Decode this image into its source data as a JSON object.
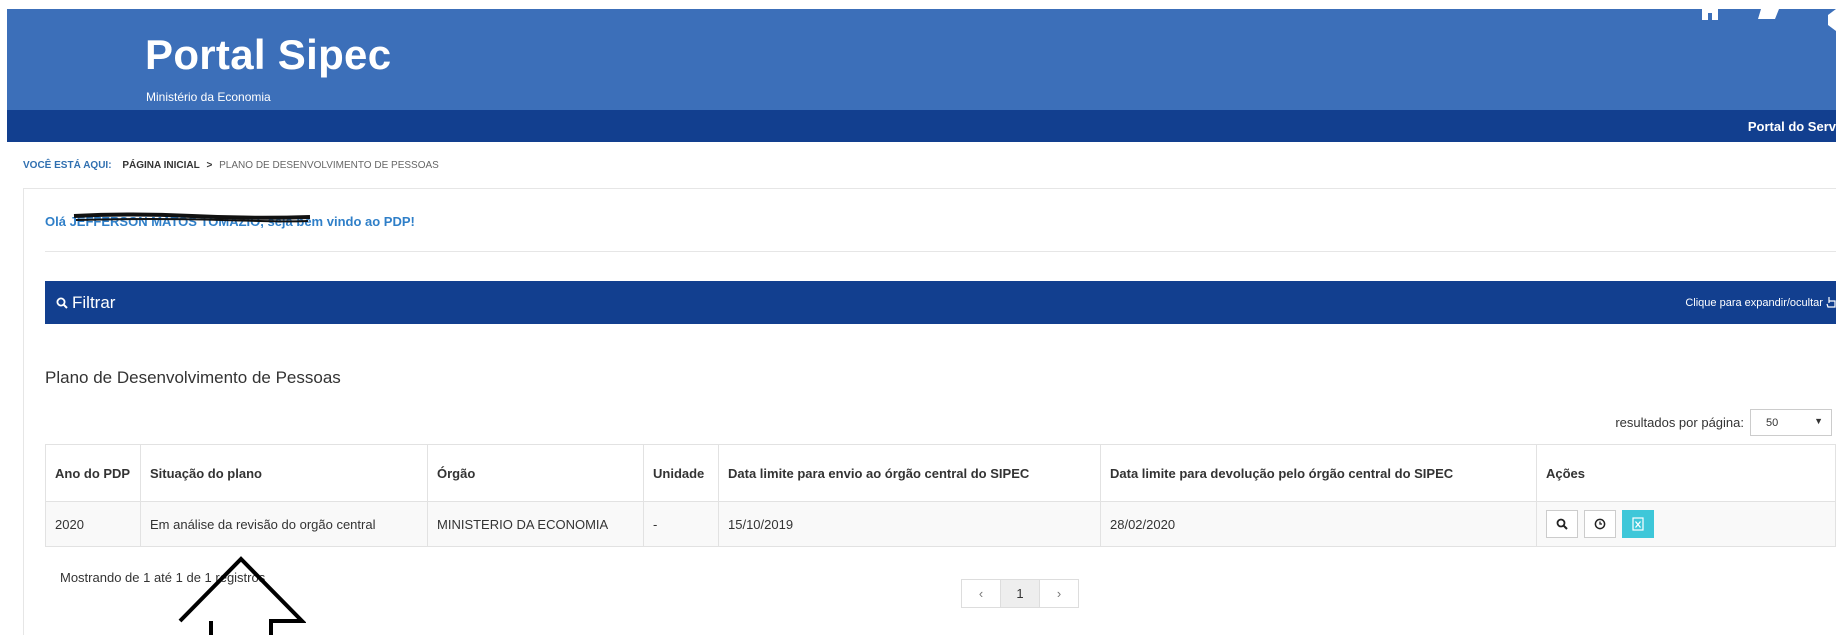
{
  "header": {
    "title": "Portal Sipec",
    "subtitle": "Ministério da Economia",
    "portal_link": "Portal do Serv",
    "brand_color": "#3c6fb9",
    "nav_color": "#123f8f"
  },
  "breadcrumb": {
    "lead": "VOCÊ ESTÁ AQUI:",
    "home": "PÁGINA INICIAL",
    "separator": ">",
    "current": "PLANO DE DESENVOLVIMENTO DE PESSOAS"
  },
  "welcome": {
    "greeting": "Olá JEFFERSON MATOS TOMAZIO, seja bem vindo ao PDP!",
    "color": "#2f7fc8"
  },
  "filter": {
    "label": "Filtrar",
    "toggle_label": "Clique para expandir/ocultar"
  },
  "section": {
    "title": "Plano de Desenvolvimento de Pessoas",
    "per_page_label": "resultados por página:",
    "per_page_value": "50"
  },
  "table": {
    "headers": [
      "Ano do PDP",
      "Situação do plano",
      "Órgão",
      "Unidade",
      "Data limite para envio ao órgão central do SIPEC",
      "Data limite para devolução pelo órgão central do SIPEC",
      "Ações"
    ],
    "rows": [
      {
        "ano": "2020",
        "situacao": "Em análise da revisão do orgão central",
        "orgao": "MINISTERIO DA ECONOMIA",
        "unidade": "-",
        "data_envio": "15/10/2019",
        "data_devolucao": "28/02/2020",
        "actions": [
          "search-icon",
          "clock-icon",
          "excel-icon"
        ]
      }
    ]
  },
  "footer": {
    "showing": "Mostrando de 1 até 1 de 1 registros",
    "pagination": {
      "prev": "‹",
      "pages": [
        "1"
      ],
      "current": "1",
      "next": "›"
    }
  },
  "colors": {
    "excel_button": "#3ec7d9"
  }
}
